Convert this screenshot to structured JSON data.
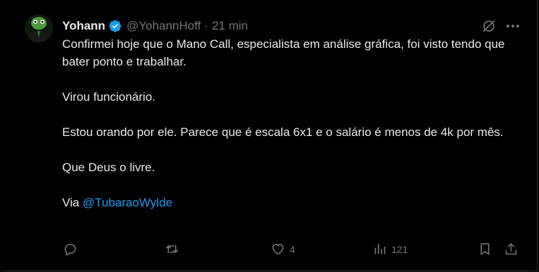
{
  "tweet": {
    "display_name": "Yohann",
    "handle": "@YohannHoff",
    "separator": "·",
    "time": "21 min",
    "lines": [
      "Confirmei hoje que o Mano Call, especialista em análise gráfica, foi visto tendo que bater ponto e trabalhar.",
      "Virou funcionário.",
      "Estou orando por ele. Parece que é escala 6x1 e o salário é menos de 4k por mês.",
      "Que Deus o livre."
    ],
    "via_label": "Via",
    "via_mention": "@TubaraoWylde"
  },
  "actions": {
    "likes": "4",
    "views": "121"
  },
  "colors": {
    "background": "#000000",
    "text": "#e7e9ea",
    "muted": "#71767b",
    "link": "#1d9bf0",
    "verified": "#1d9bf0"
  },
  "icons": [
    "verified-badge-icon",
    "grok-icon",
    "more-icon",
    "reply-icon",
    "retweet-icon",
    "like-icon",
    "views-icon",
    "bookmark-icon",
    "share-icon"
  ]
}
